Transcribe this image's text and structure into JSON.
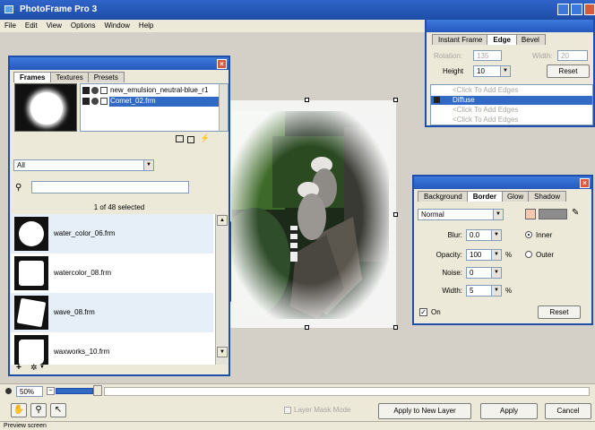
{
  "app": {
    "title": "PhotoFrame Pro 3"
  },
  "menu": [
    "File",
    "Edit",
    "View",
    "Options",
    "Window",
    "Help"
  ],
  "frames_panel": {
    "tabs": [
      "Frames",
      "Textures",
      "Presets"
    ],
    "layers": [
      "new_emulsion_neutral-blue_r1",
      "Comet_02.frm"
    ],
    "category": "All",
    "search_value": "",
    "selection_status": "1 of 48 selected",
    "items": [
      {
        "label": "water_color_06.frm"
      },
      {
        "label": "watercolor_08.frm"
      },
      {
        "label": "wave_08.frm"
      },
      {
        "label": "waxworks_10.frm"
      }
    ]
  },
  "edge_panel": {
    "tabs": [
      "Instant Frame",
      "Edge",
      "Bevel"
    ],
    "rotation_label": "Rotation:",
    "rotation_value": "135",
    "width_label": "Width:",
    "width_value": "20",
    "height_label": "Height",
    "height_value": "10",
    "reset_label": "Reset",
    "edges": [
      "<Click To Add Edges",
      "Diffuse",
      "<Click To Add Edges",
      "<Click To Add Edges"
    ]
  },
  "border_panel": {
    "tabs": [
      "Background",
      "Border",
      "Glow",
      "Shadow"
    ],
    "mode": "Normal",
    "blur_label": "Blur:",
    "blur_value": "0.0",
    "opacity_label": "Opacity:",
    "opacity_value": "100",
    "opacity_unit": "%",
    "noise_label": "Noise:",
    "noise_value": "0",
    "width_label": "Width:",
    "width_value": "5",
    "width_unit": "%",
    "inner_label": "Inner",
    "outer_label": "Outer",
    "on_label": "On",
    "reset_label": "Reset",
    "color": "#8c8c8c"
  },
  "bottom": {
    "zoom_value": "50%",
    "layer_mask_label": "Layer Mask Mode",
    "apply_new_layer_label": "Apply to New Layer",
    "apply_label": "Apply",
    "cancel_label": "Cancel",
    "status": "Preview screen"
  },
  "colors": {
    "titlebar": "#1f4ea8",
    "selection": "#316ac5",
    "workspace": "#d4d0c8"
  }
}
